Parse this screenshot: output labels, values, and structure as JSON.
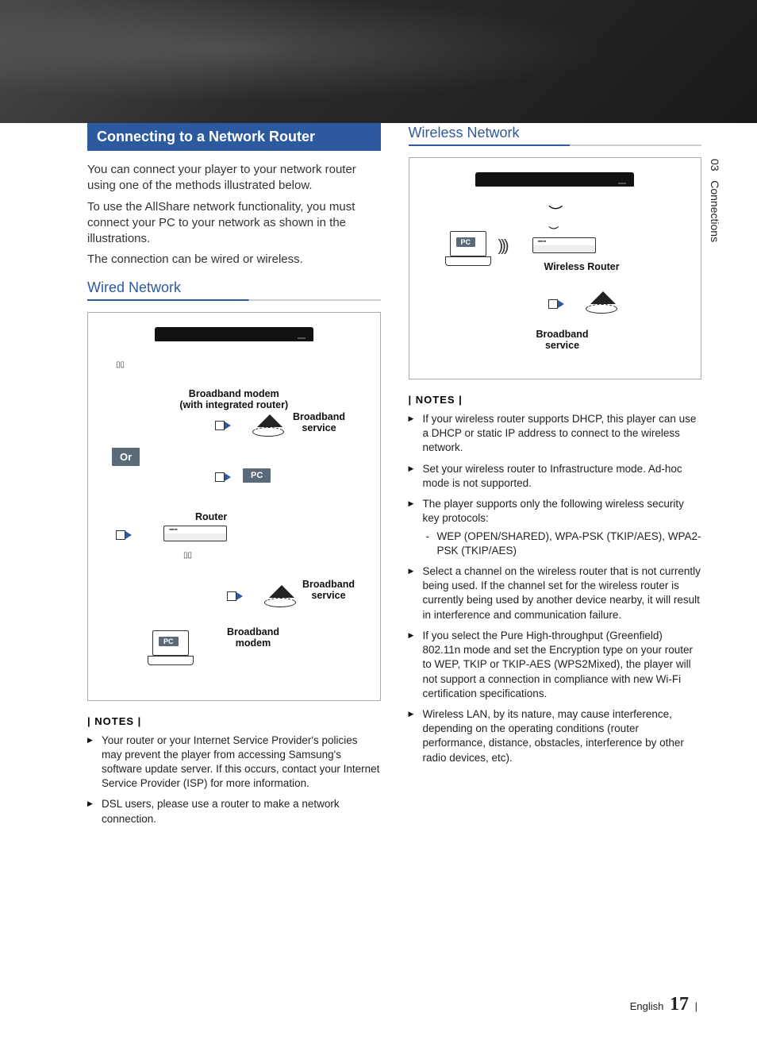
{
  "side_tab": {
    "number": "03",
    "label": "Connections"
  },
  "section_header": "Connecting to a Network Router",
  "intro": {
    "p1": "You can connect your player to your network router using one of the methods illustrated below.",
    "p2": "To use the AllShare network functionality, you must connect your PC to your network as shown in the illustrations.",
    "p3": "The connection can be wired or wireless."
  },
  "wired": {
    "heading": "Wired Network",
    "labels": {
      "broadband_modem_integrated": "Broadband modem",
      "integrated_sub": "(with integrated router)",
      "broadband_service": "Broadband",
      "broadband_service2": "service",
      "or": "Or",
      "pc": "PC",
      "router": "Router",
      "broadband_modem": "Broadband",
      "broadband_modem2": "modem"
    },
    "notes_header": "| NOTES |",
    "notes": [
      "Your router or your Internet Service Provider's policies may prevent the player from accessing Samsung's software update server. If this occurs, contact your Internet Service Provider (ISP) for more information.",
      "DSL users, please use a router to make a network connection."
    ]
  },
  "wireless": {
    "heading": "Wireless Network",
    "labels": {
      "pc": "PC",
      "wireless_router": "Wireless Router",
      "broadband_service": "Broadband",
      "broadband_service2": "service"
    },
    "notes_header": "| NOTES |",
    "notes": [
      "If your wireless router supports DHCP, this player can use a DHCP or static IP address to connect to the wireless network.",
      "Set your wireless router to Infrastructure mode. Ad-hoc mode is not supported.",
      "The player supports only the following wireless security key protocols:",
      "Select a channel on the wireless router that is not currently being used. If the channel set for the wireless router is currently being used by another device nearby, it will result in interference and communication failure.",
      "If you select the Pure High-throughput (Greenfield) 802.11n mode and set the Encryption type on your router to WEP, TKIP or TKIP-AES (WPS2Mixed), the player will not support a connection in compliance with new Wi-Fi certification specifications.",
      "Wireless LAN, by its nature, may cause interference, depending on the operating conditions (router performance, distance, obstacles, interference by other radio devices, etc)."
    ],
    "protocols_sub": "WEP (OPEN/SHARED), WPA-PSK (TKIP/AES), WPA2-PSK (TKIP/AES)"
  },
  "footer": {
    "lang": "English",
    "page": "17"
  }
}
